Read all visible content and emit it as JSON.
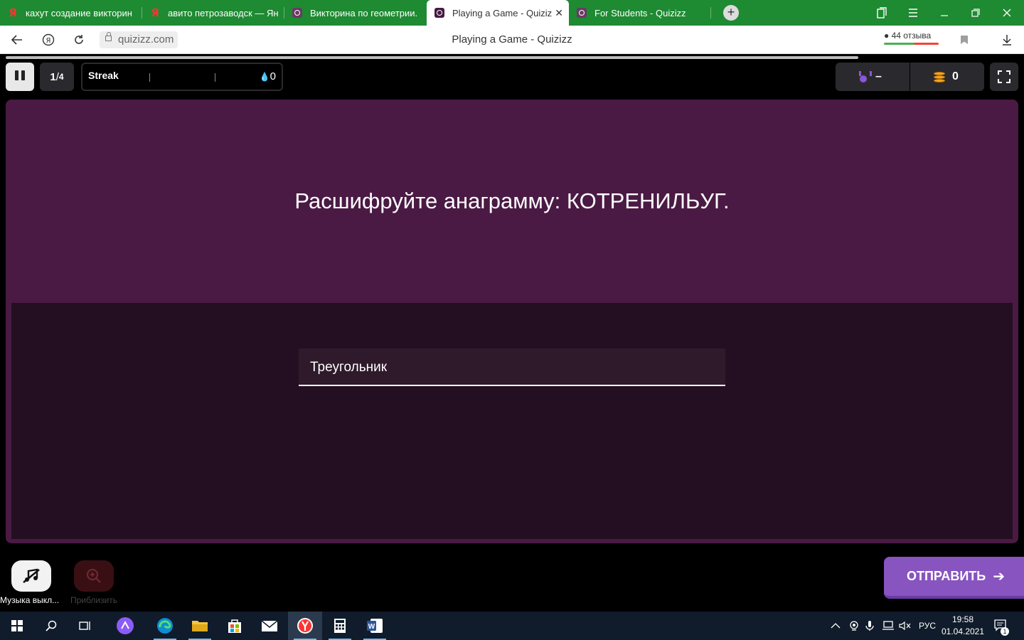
{
  "browser": {
    "tabs": [
      {
        "title": "кахут создание викторин",
        "favicon": "yandex-icon"
      },
      {
        "title": "авито петрозаводск — Ян",
        "favicon": "yandex-icon"
      },
      {
        "title": "Викторина по геометрии.",
        "favicon": "quizizz-icon"
      },
      {
        "title": "Playing a Game - Quiziz",
        "favicon": "quizizz-icon",
        "active": true
      },
      {
        "title": "For Students - Quizizz",
        "favicon": "quizizz-icon"
      }
    ],
    "url": "quizizz.com",
    "page_title": "Playing a Game - Quizizz",
    "reviews": "44 отзыва",
    "accent_color": "#1e8a32"
  },
  "quiz": {
    "question_counter": {
      "current": "1",
      "total": "4"
    },
    "streak": {
      "label": "Streak",
      "count": "0"
    },
    "rank": "–",
    "coins": "0",
    "question": "Расшифруйте анаграмму: КОТРЕНИЛЬУГ.",
    "answer_value": "Треугольник",
    "submit_label": "ОТПРАВИТЬ",
    "music_label": "Музыка выкл...",
    "zoom_label": "Приблизить",
    "colors": {
      "panel": "#4a1a44",
      "answer_area": "#230f21",
      "submit": "#8854c0"
    }
  },
  "taskbar": {
    "apps": [
      "windows-start-icon",
      "search-icon",
      "task-view-icon",
      "alice-icon",
      "edge-icon",
      "file-explorer-icon",
      "store-icon",
      "mail-icon",
      "yandex-browser-icon",
      "calculator-icon",
      "word-icon"
    ],
    "language": "РУС",
    "time": "19:58",
    "date": "01.04.2021",
    "notifications": "1"
  }
}
